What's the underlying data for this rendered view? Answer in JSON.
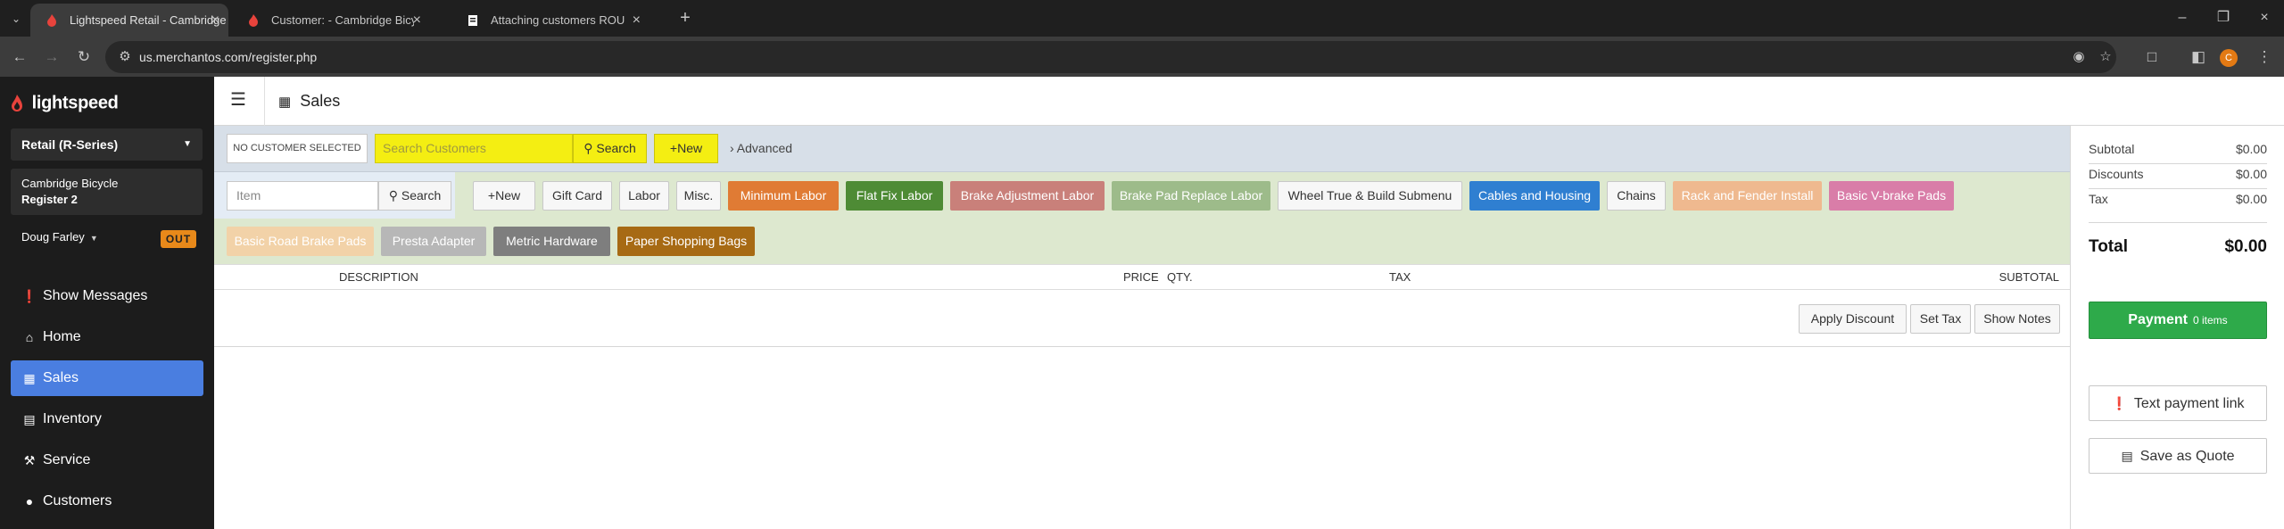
{
  "browser": {
    "tabs": [
      {
        "title": "Lightspeed Retail - Cambridge Bic",
        "active": true
      },
      {
        "title": "Customer: - Cambridge Bicycle",
        "active": false
      },
      {
        "title": "Attaching customers ROUGH DRAFT",
        "active": false
      }
    ],
    "url": "us.merchantos.com/register.php",
    "profile_initial": "C"
  },
  "sidebar": {
    "brand": "lightspeed",
    "shop_select": "Retail (R-Series)",
    "shop_name": "Cambridge Bicycle",
    "register": "Register 2",
    "user": "Doug Farley",
    "out_badge": "OUT",
    "nav": [
      {
        "label": "Show Messages",
        "icon": "info-icon"
      },
      {
        "label": "Home",
        "icon": "home-icon"
      },
      {
        "label": "Sales",
        "icon": "sales-icon",
        "active": true
      },
      {
        "label": "Inventory",
        "icon": "inventory-icon"
      },
      {
        "label": "Service",
        "icon": "wrench-icon"
      },
      {
        "label": "Customers",
        "icon": "customer-icon"
      }
    ]
  },
  "header": {
    "title": "Sales"
  },
  "customer_bar": {
    "no_customer": "NO CUSTOMER SELECTED",
    "search_placeholder": "Search Customers",
    "search_label": "Search",
    "new_label": "New",
    "advanced_label": "Advanced"
  },
  "item_bar": {
    "placeholder": "Item",
    "search_label": "Search",
    "quick_buttons": [
      {
        "label": "New",
        "color": "#f7f7f7"
      },
      {
        "label": "Gift Card",
        "color": "#f7f7f7"
      },
      {
        "label": "Labor",
        "color": "#f7f7f7"
      },
      {
        "label": "Misc.",
        "color": "#f7f7f7"
      },
      {
        "label": "Minimum Labor",
        "color": "#e07b34"
      },
      {
        "label": "Flat Fix Labor",
        "color": "#4e8b35"
      },
      {
        "label": "Brake Adjustment Labor",
        "color": "#c9807a"
      },
      {
        "label": "Brake Pad Replace Labor",
        "color": "#9dbb8a"
      },
      {
        "label": "Wheel True & Build Submenu",
        "color": "#f7f7f7"
      },
      {
        "label": "Cables and Housing",
        "color": "#2f7fd1"
      },
      {
        "label": "Chains",
        "color": "#f7f7f7"
      },
      {
        "label": "Rack and Fender Install",
        "color": "#efb98f"
      },
      {
        "label": "Basic V-brake Pads",
        "color": "#d97da8"
      },
      {
        "label": "Basic Road Brake Pads",
        "color": "#f2d2a8"
      },
      {
        "label": "Presta Adapter",
        "color": "#b7b7b7"
      },
      {
        "label": "Metric Hardware",
        "color": "#7e7e7e"
      },
      {
        "label": "Paper Shopping Bags",
        "color": "#a76a14"
      }
    ]
  },
  "table": {
    "columns": [
      "DESCRIPTION",
      "PRICE",
      "QTY.",
      "TAX",
      "SUBTOTAL"
    ],
    "actions": [
      "Apply Discount",
      "Set Tax",
      "Show Notes"
    ]
  },
  "summary": {
    "subtotal_label": "Subtotal",
    "subtotal": "$0.00",
    "discounts_label": "Discounts",
    "discounts": "$0.00",
    "tax_label": "Tax",
    "tax": "$0.00",
    "total_label": "Total",
    "total": "$0.00",
    "payment_label": "Payment",
    "payment_items": "0 items",
    "text_link_label": "Text payment link",
    "quote_label": "Save as Quote"
  }
}
